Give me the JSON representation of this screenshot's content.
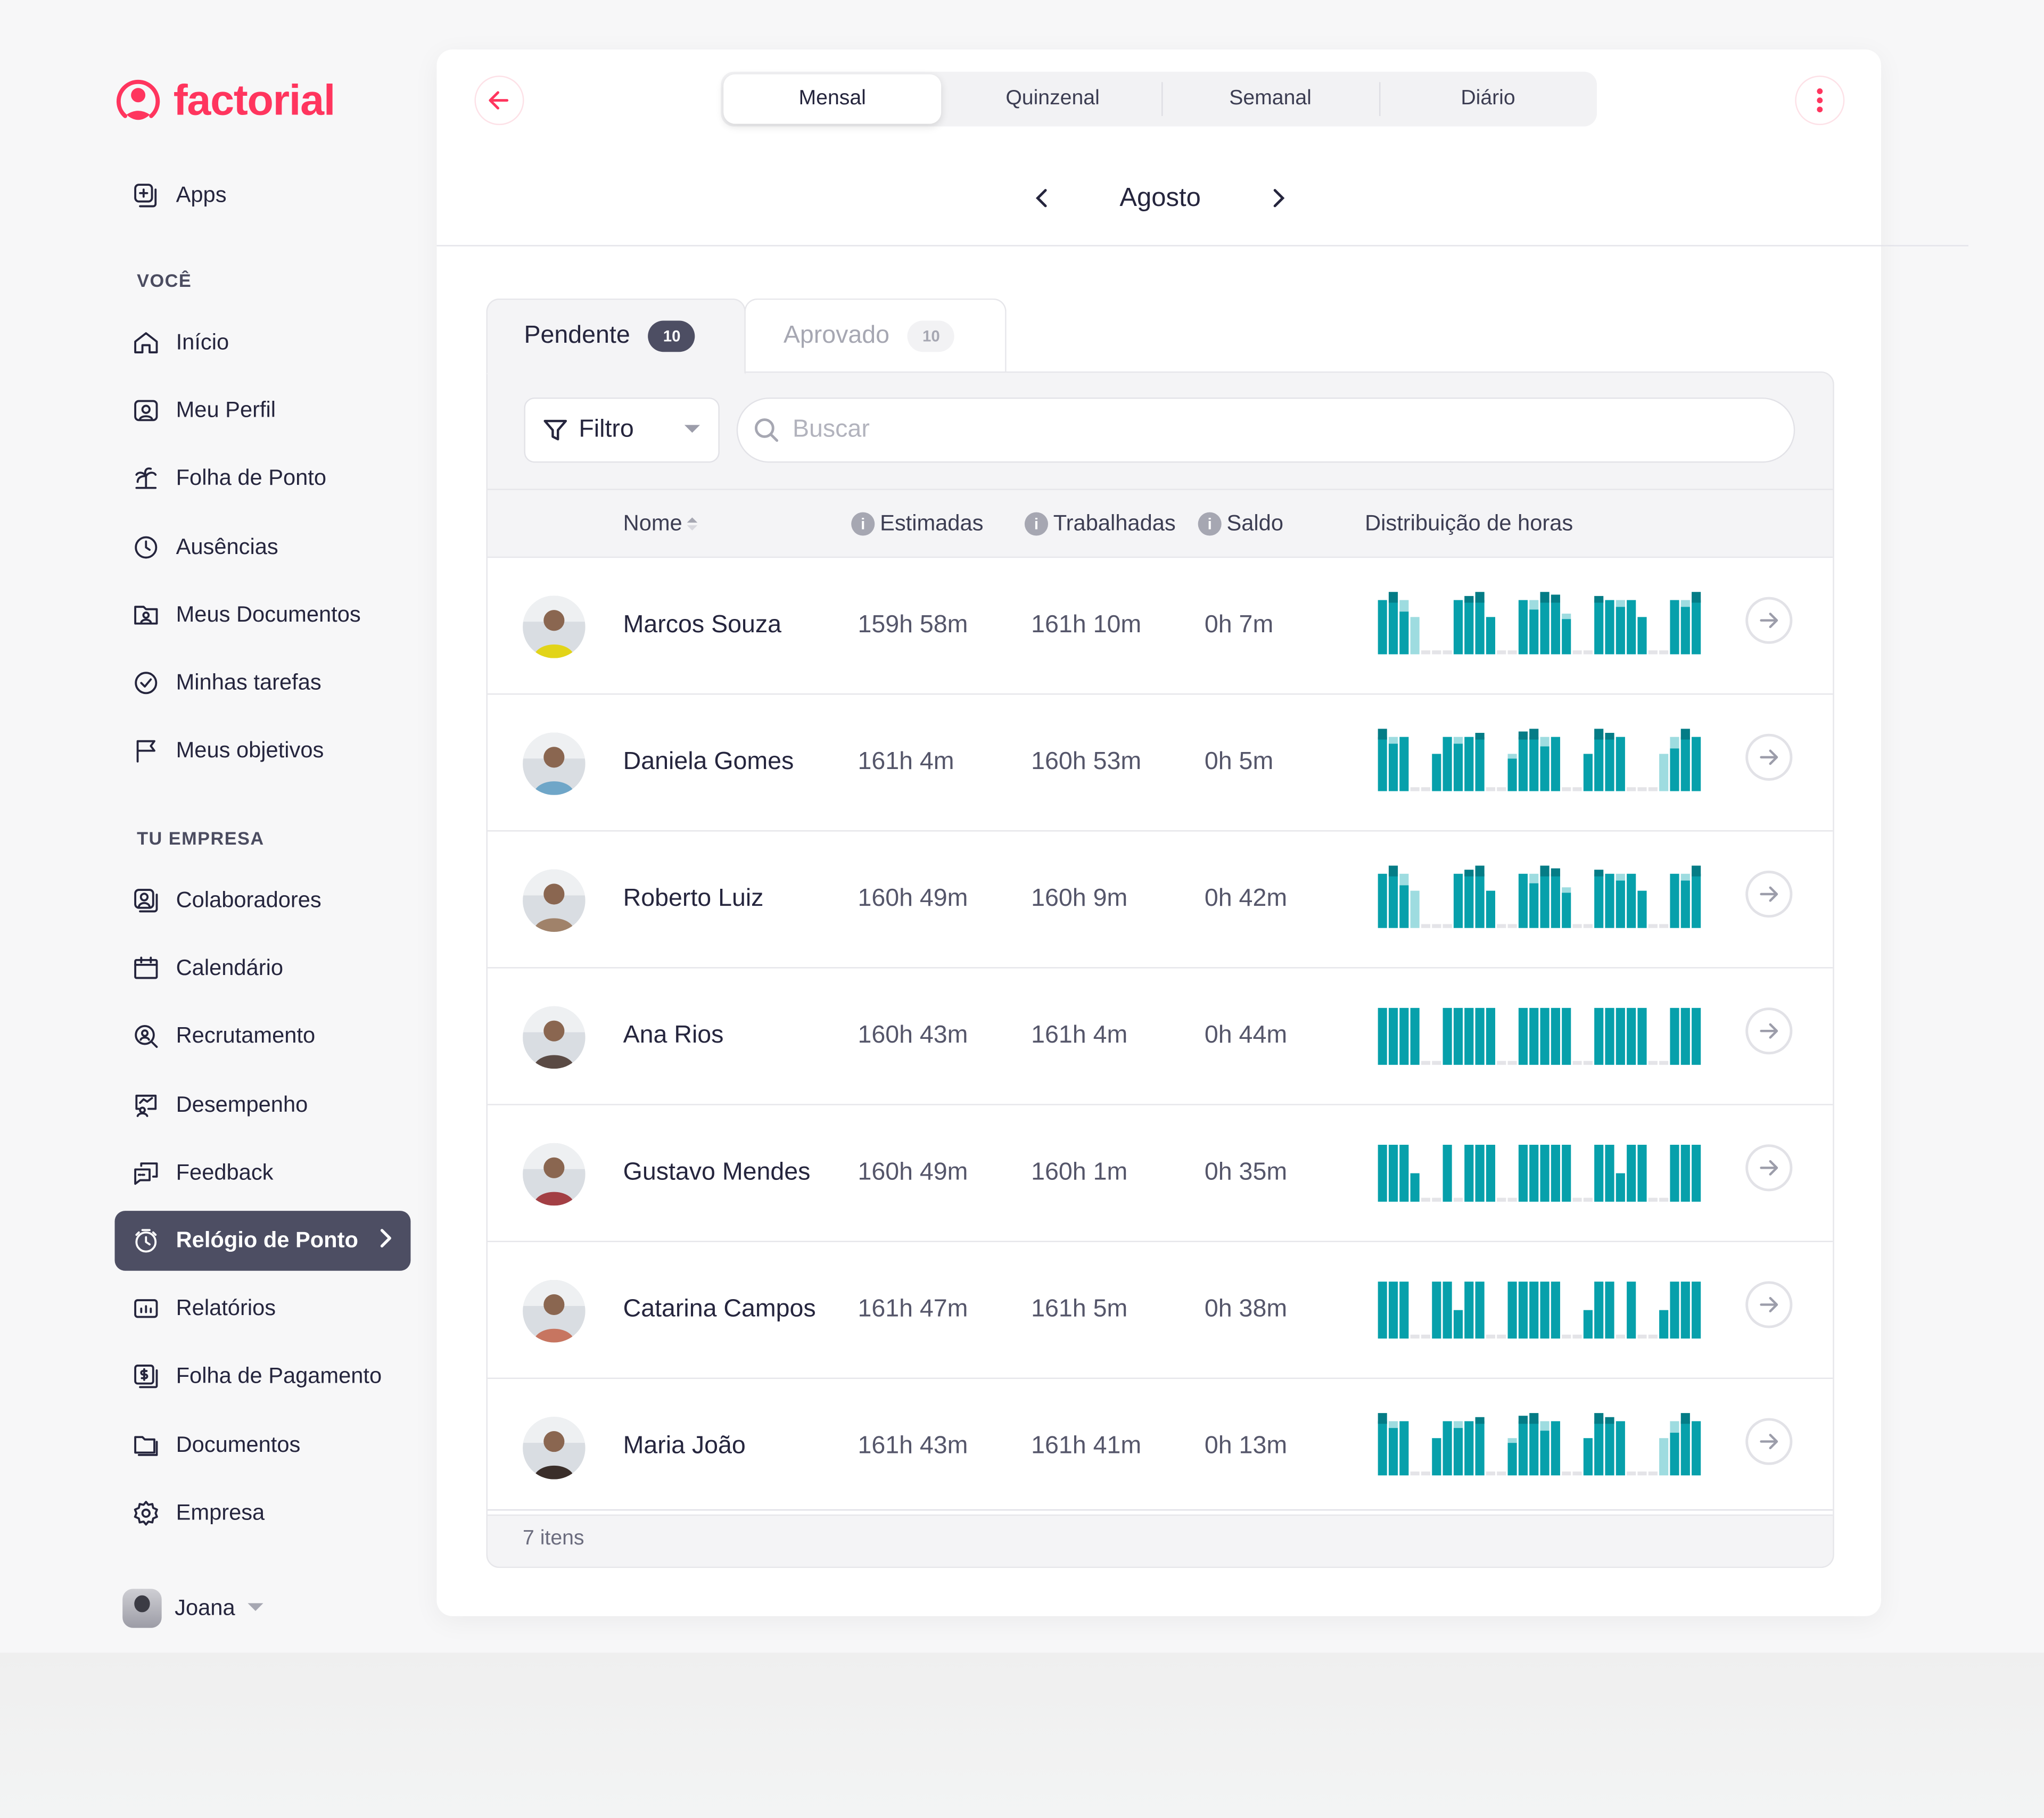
{
  "brand": {
    "name": "factorial",
    "color": "#ff355e"
  },
  "sidebar": {
    "apps": {
      "label": "Apps",
      "icon": "apps-icon"
    },
    "sections": [
      {
        "title": "VOCÊ",
        "items": [
          {
            "label": "Início",
            "icon": "home-icon"
          },
          {
            "label": "Meu Perfil",
            "icon": "profile-icon"
          },
          {
            "label": "Folha de Ponto",
            "icon": "palm-tree-icon"
          },
          {
            "label": "Ausências",
            "icon": "clock-icon"
          },
          {
            "label": "Meus Documentos",
            "icon": "user-folder-icon"
          },
          {
            "label": "Minhas tarefas",
            "icon": "check-circle-icon"
          },
          {
            "label": "Meus objetivos",
            "icon": "flag-icon"
          }
        ]
      },
      {
        "title": "TU EMPRESA",
        "items": [
          {
            "label": "Colaboradores",
            "icon": "people-icon"
          },
          {
            "label": "Calendário",
            "icon": "calendar-icon"
          },
          {
            "label": "Recrutamento",
            "icon": "recruit-search-icon"
          },
          {
            "label": "Desempenho",
            "icon": "performance-icon"
          },
          {
            "label": "Feedback",
            "icon": "chat-icon"
          },
          {
            "label": "Relógio de Ponto",
            "icon": "stopwatch-icon",
            "active": true
          },
          {
            "label": "Relatórios",
            "icon": "report-icon"
          },
          {
            "label": "Folha de Pagamento",
            "icon": "payroll-icon"
          },
          {
            "label": "Documentos",
            "icon": "folder-icon"
          },
          {
            "label": "Empresa",
            "icon": "gear-icon"
          }
        ]
      }
    ],
    "user": {
      "name": "Joana"
    }
  },
  "header": {
    "periods": [
      {
        "label": "Mensal",
        "selected": true
      },
      {
        "label": "Quinzenal"
      },
      {
        "label": "Semanal"
      },
      {
        "label": "Diário"
      }
    ],
    "month": "Agosto"
  },
  "tabs": [
    {
      "label": "Pendente",
      "count": "10",
      "active": true
    },
    {
      "label": "Aprovado",
      "count": "10"
    }
  ],
  "toolbar": {
    "filter_label": "Filtro",
    "search_placeholder": "Buscar",
    "search_value": ""
  },
  "table": {
    "columns": {
      "name": "Nome",
      "estimated": "Estimadas",
      "worked": "Trabalhadas",
      "balance": "Saldo",
      "distribution": "Distribuição de horas"
    },
    "colors": {
      "base": "#07a0ab",
      "over": "#047c86",
      "under": "#9edce0",
      "weekend": "#e4e4e8"
    },
    "rows": [
      {
        "name": "Marcos Souza",
        "estimated": "159h 58m",
        "worked": "161h 10m",
        "balance": "0h 7m",
        "avatar_color": "#e2d418",
        "days": [
          [
            0.8,
            0,
            "n"
          ],
          [
            0.8,
            0.12,
            "o"
          ],
          [
            0.8,
            -0.17,
            "u"
          ],
          [
            0.55,
            0,
            "l"
          ],
          [
            0,
            0,
            "w"
          ],
          [
            0,
            0,
            "w"
          ],
          [
            0,
            0,
            "w"
          ],
          [
            0.8,
            0,
            "n"
          ],
          [
            0.8,
            0.06,
            "o"
          ],
          [
            0.8,
            0.12,
            "o"
          ],
          [
            0.55,
            0,
            "n"
          ],
          [
            0,
            0,
            "w"
          ],
          [
            0,
            0,
            "w"
          ],
          [
            0.8,
            0,
            "n"
          ],
          [
            0.8,
            -0.14,
            "u"
          ],
          [
            0.8,
            0.12,
            "o"
          ],
          [
            0.8,
            0.08,
            "o"
          ],
          [
            0.6,
            -0.08,
            "u"
          ],
          [
            0,
            0,
            "w"
          ],
          [
            0,
            0,
            "w"
          ],
          [
            0.8,
            0.06,
            "o"
          ],
          [
            0.8,
            0,
            "n"
          ],
          [
            0.8,
            -0.1,
            "u"
          ],
          [
            0.8,
            0,
            "n"
          ],
          [
            0.55,
            0,
            "n"
          ],
          [
            0,
            0,
            "w"
          ],
          [
            0,
            0,
            "w"
          ],
          [
            0.8,
            0,
            "n"
          ],
          [
            0.8,
            -0.1,
            "u"
          ],
          [
            0.8,
            0.12,
            "o"
          ]
        ]
      },
      {
        "name": "Daniela Gomes",
        "estimated": "161h 4m",
        "worked": "160h 53m",
        "balance": "0h 5m",
        "avatar_color": "#6fa6c8",
        "days": [
          [
            0.8,
            0.12,
            "o"
          ],
          [
            0.8,
            -0.1,
            "u"
          ],
          [
            0.8,
            0,
            "n"
          ],
          [
            0,
            0,
            "w"
          ],
          [
            0,
            0,
            "w"
          ],
          [
            0.55,
            0,
            "n"
          ],
          [
            0.8,
            0,
            "n"
          ],
          [
            0.8,
            -0.1,
            "u"
          ],
          [
            0.8,
            0,
            "n"
          ],
          [
            0.8,
            0.06,
            "o"
          ],
          [
            0,
            0,
            "w"
          ],
          [
            0,
            0,
            "w"
          ],
          [
            0.55,
            -0.07,
            "u"
          ],
          [
            0.8,
            0.08,
            "o"
          ],
          [
            0.8,
            0.12,
            "o"
          ],
          [
            0.8,
            -0.14,
            "u"
          ],
          [
            0.8,
            0,
            "n"
          ],
          [
            0,
            0,
            "w"
          ],
          [
            0,
            0,
            "w"
          ],
          [
            0.55,
            0,
            "n"
          ],
          [
            0.8,
            0.12,
            "o"
          ],
          [
            0.8,
            0.06,
            "o"
          ],
          [
            0.8,
            0,
            "n"
          ],
          [
            0,
            0,
            "w"
          ],
          [
            0,
            0,
            "w"
          ],
          [
            0,
            0,
            "w"
          ],
          [
            0.55,
            0,
            "l"
          ],
          [
            0.8,
            -0.17,
            "u"
          ],
          [
            0.8,
            0.12,
            "o"
          ],
          [
            0.8,
            0,
            "n"
          ]
        ]
      },
      {
        "name": "Roberto Luiz",
        "estimated": "160h 49m",
        "worked": "160h 9m",
        "balance": "0h 42m",
        "avatar_color": "#a0826a",
        "days": [
          [
            0.8,
            0,
            "n"
          ],
          [
            0.8,
            0.12,
            "o"
          ],
          [
            0.8,
            -0.17,
            "u"
          ],
          [
            0.55,
            0,
            "l"
          ],
          [
            0,
            0,
            "w"
          ],
          [
            0,
            0,
            "w"
          ],
          [
            0,
            0,
            "w"
          ],
          [
            0.8,
            0,
            "n"
          ],
          [
            0.8,
            0.06,
            "o"
          ],
          [
            0.8,
            0.12,
            "o"
          ],
          [
            0.55,
            0,
            "n"
          ],
          [
            0,
            0,
            "w"
          ],
          [
            0,
            0,
            "w"
          ],
          [
            0.8,
            0,
            "n"
          ],
          [
            0.8,
            -0.14,
            "u"
          ],
          [
            0.8,
            0.12,
            "o"
          ],
          [
            0.8,
            0.08,
            "o"
          ],
          [
            0.6,
            -0.08,
            "u"
          ],
          [
            0,
            0,
            "w"
          ],
          [
            0,
            0,
            "w"
          ],
          [
            0.8,
            0.06,
            "o"
          ],
          [
            0.8,
            0,
            "n"
          ],
          [
            0.8,
            -0.1,
            "u"
          ],
          [
            0.8,
            0,
            "n"
          ],
          [
            0.55,
            0,
            "n"
          ],
          [
            0,
            0,
            "w"
          ],
          [
            0,
            0,
            "w"
          ],
          [
            0.8,
            0,
            "n"
          ],
          [
            0.8,
            -0.1,
            "u"
          ],
          [
            0.8,
            0.12,
            "o"
          ]
        ]
      },
      {
        "name": "Ana Rios",
        "estimated": "160h 43m",
        "worked": "161h 4m",
        "balance": "0h 44m",
        "avatar_color": "#5a4a44",
        "days": [
          [
            0.84,
            0,
            "n"
          ],
          [
            0.84,
            0,
            "n"
          ],
          [
            0.84,
            0,
            "n"
          ],
          [
            0.84,
            0,
            "n"
          ],
          [
            0,
            0,
            "w"
          ],
          [
            0,
            0,
            "w"
          ],
          [
            0.84,
            0,
            "n"
          ],
          [
            0.84,
            0,
            "n"
          ],
          [
            0.84,
            0,
            "n"
          ],
          [
            0.84,
            0,
            "n"
          ],
          [
            0.84,
            0,
            "n"
          ],
          [
            0,
            0,
            "w"
          ],
          [
            0,
            0,
            "w"
          ],
          [
            0.84,
            0,
            "n"
          ],
          [
            0.84,
            0,
            "n"
          ],
          [
            0.84,
            0,
            "n"
          ],
          [
            0.84,
            0,
            "n"
          ],
          [
            0.84,
            0,
            "n"
          ],
          [
            0,
            0,
            "w"
          ],
          [
            0,
            0,
            "w"
          ],
          [
            0.84,
            0,
            "n"
          ],
          [
            0.84,
            0,
            "n"
          ],
          [
            0.84,
            0,
            "n"
          ],
          [
            0.84,
            0,
            "n"
          ],
          [
            0.84,
            0,
            "n"
          ],
          [
            0,
            0,
            "w"
          ],
          [
            0,
            0,
            "w"
          ],
          [
            0.84,
            0,
            "n"
          ],
          [
            0.84,
            0,
            "n"
          ],
          [
            0.84,
            0,
            "n"
          ]
        ]
      },
      {
        "name": "Gustavo Mendes",
        "estimated": "160h 49m",
        "worked": "160h 1m",
        "balance": "0h 35m",
        "avatar_color": "#a33f44",
        "days": [
          [
            0.84,
            0,
            "n"
          ],
          [
            0.84,
            0,
            "n"
          ],
          [
            0.84,
            0,
            "n"
          ],
          [
            0.42,
            0,
            "n"
          ],
          [
            0,
            0,
            "w"
          ],
          [
            0,
            0,
            "w"
          ],
          [
            0.84,
            0,
            "n"
          ],
          [
            0,
            0,
            "w"
          ],
          [
            0.84,
            0,
            "n"
          ],
          [
            0.84,
            0,
            "n"
          ],
          [
            0.84,
            0,
            "n"
          ],
          [
            0,
            0,
            "w"
          ],
          [
            0,
            0,
            "w"
          ],
          [
            0.84,
            0,
            "n"
          ],
          [
            0.84,
            0,
            "n"
          ],
          [
            0.84,
            0,
            "n"
          ],
          [
            0.84,
            0,
            "n"
          ],
          [
            0.84,
            0,
            "n"
          ],
          [
            0,
            0,
            "w"
          ],
          [
            0,
            0,
            "w"
          ],
          [
            0.84,
            0,
            "n"
          ],
          [
            0.84,
            0,
            "n"
          ],
          [
            0.42,
            0,
            "n"
          ],
          [
            0.84,
            0,
            "n"
          ],
          [
            0.84,
            0,
            "n"
          ],
          [
            0,
            0,
            "w"
          ],
          [
            0,
            0,
            "w"
          ],
          [
            0.84,
            0,
            "n"
          ],
          [
            0.84,
            0,
            "n"
          ],
          [
            0.84,
            0,
            "n"
          ]
        ]
      },
      {
        "name": "Catarina Campos",
        "estimated": "161h 47m",
        "worked": "161h 5m",
        "balance": "0h 38m",
        "avatar_color": "#c77560",
        "days": [
          [
            0.84,
            0,
            "n"
          ],
          [
            0.84,
            0,
            "n"
          ],
          [
            0.84,
            0,
            "n"
          ],
          [
            0,
            0,
            "w"
          ],
          [
            0,
            0,
            "w"
          ],
          [
            0.84,
            0,
            "n"
          ],
          [
            0.84,
            0,
            "n"
          ],
          [
            0.42,
            0,
            "n"
          ],
          [
            0.84,
            0,
            "n"
          ],
          [
            0.84,
            0,
            "n"
          ],
          [
            0,
            0,
            "w"
          ],
          [
            0,
            0,
            "w"
          ],
          [
            0.84,
            0,
            "n"
          ],
          [
            0.84,
            0,
            "n"
          ],
          [
            0.84,
            0,
            "n"
          ],
          [
            0.84,
            0,
            "n"
          ],
          [
            0.84,
            0,
            "n"
          ],
          [
            0,
            0,
            "w"
          ],
          [
            0,
            0,
            "w"
          ],
          [
            0.42,
            0,
            "n"
          ],
          [
            0.84,
            0,
            "n"
          ],
          [
            0.84,
            0,
            "n"
          ],
          [
            0,
            0,
            "w"
          ],
          [
            0.84,
            0,
            "n"
          ],
          [
            0,
            0,
            "w"
          ],
          [
            0,
            0,
            "w"
          ],
          [
            0.42,
            0,
            "n"
          ],
          [
            0.84,
            0,
            "n"
          ],
          [
            0.84,
            0,
            "n"
          ],
          [
            0.84,
            0,
            "n"
          ]
        ]
      },
      {
        "name": "Maria João",
        "estimated": "161h 43m",
        "worked": "161h 41m",
        "balance": "0h 13m",
        "avatar_color": "#3a2e2a",
        "days": [
          [
            0.8,
            0.12,
            "o"
          ],
          [
            0.8,
            -0.1,
            "u"
          ],
          [
            0.8,
            0,
            "n"
          ],
          [
            0,
            0,
            "w"
          ],
          [
            0,
            0,
            "w"
          ],
          [
            0.55,
            0,
            "n"
          ],
          [
            0.8,
            0,
            "n"
          ],
          [
            0.8,
            -0.1,
            "u"
          ],
          [
            0.8,
            0,
            "n"
          ],
          [
            0.8,
            0.06,
            "o"
          ],
          [
            0,
            0,
            "w"
          ],
          [
            0,
            0,
            "w"
          ],
          [
            0.55,
            -0.07,
            "u"
          ],
          [
            0.8,
            0.08,
            "o"
          ],
          [
            0.8,
            0.12,
            "o"
          ],
          [
            0.8,
            -0.14,
            "u"
          ],
          [
            0.8,
            0,
            "n"
          ],
          [
            0,
            0,
            "w"
          ],
          [
            0,
            0,
            "w"
          ],
          [
            0.55,
            0,
            "n"
          ],
          [
            0.8,
            0.12,
            "o"
          ],
          [
            0.8,
            0.06,
            "o"
          ],
          [
            0.8,
            0,
            "n"
          ],
          [
            0,
            0,
            "w"
          ],
          [
            0,
            0,
            "w"
          ],
          [
            0,
            0,
            "w"
          ],
          [
            0.55,
            0,
            "l"
          ],
          [
            0.8,
            -0.17,
            "u"
          ],
          [
            0.8,
            0.12,
            "o"
          ],
          [
            0.8,
            0
          ]
        ]
      }
    ],
    "footer": "7 itens"
  }
}
